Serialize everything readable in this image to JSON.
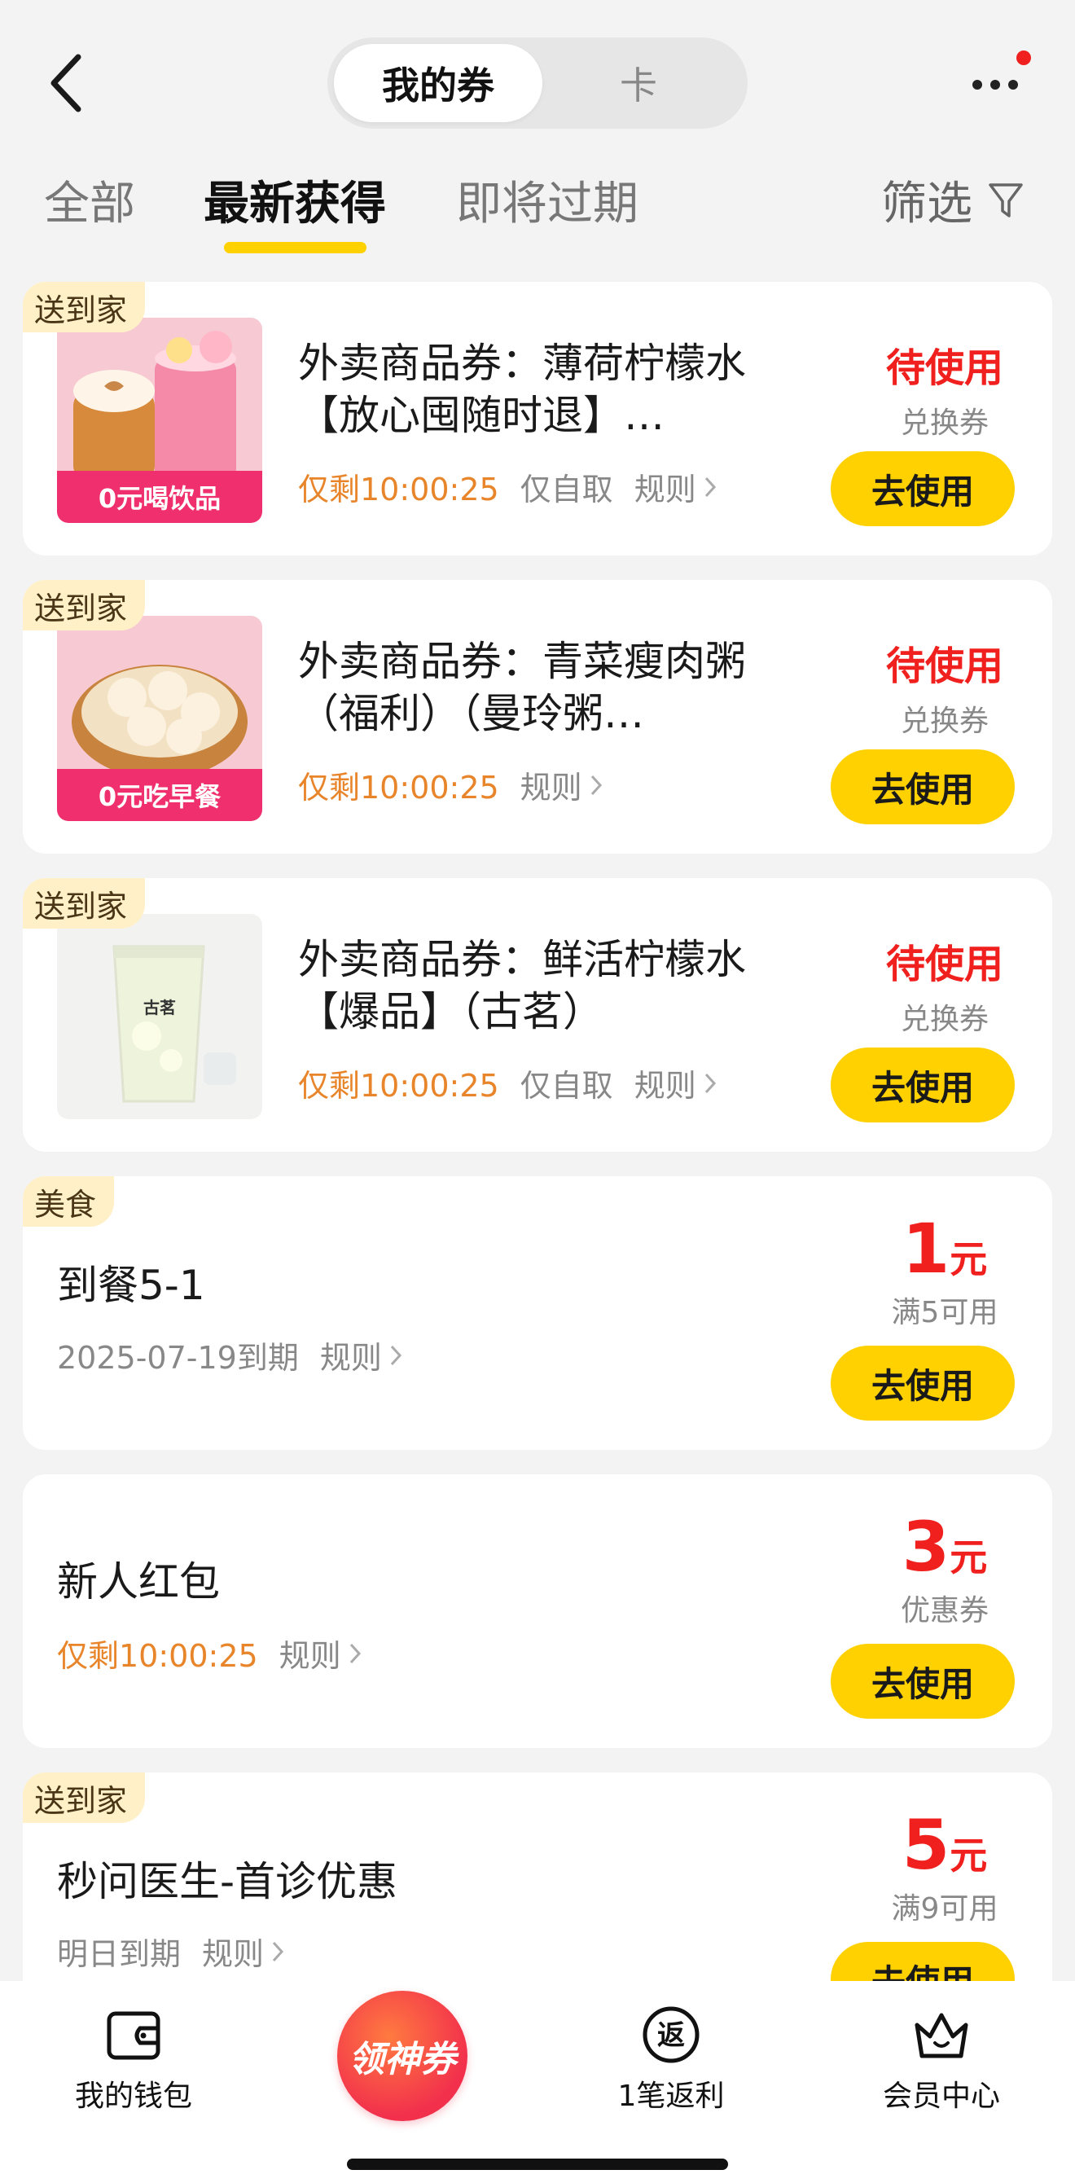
{
  "header": {
    "segments": [
      "我的券",
      "卡"
    ],
    "tabs": [
      "全部",
      "最新获得",
      "即将过期"
    ],
    "filter_label": "筛选"
  },
  "coupons": [
    {
      "tag": "送到家",
      "thumb_banner": "0元喝饮品",
      "title": "外卖商品券：薄荷柠檬水【放心囤随时退】…",
      "countdown": "仅剩10:00:25",
      "pickup": "仅自取",
      "rule": "规则",
      "status": "待使用",
      "type": "兑换券",
      "button": "去使用"
    },
    {
      "tag": "送到家",
      "thumb_banner": "0元吃早餐",
      "title": "外卖商品券：青菜瘦肉粥（福利）（曼玲粥…",
      "countdown": "仅剩10:00:25",
      "rule": "规则",
      "status": "待使用",
      "type": "兑换券",
      "button": "去使用"
    },
    {
      "tag": "送到家",
      "thumb_label": "古茗",
      "title": "外卖商品券：鲜活柠檬水【爆品】（古茗）",
      "countdown": "仅剩10:00:25",
      "pickup": "仅自取",
      "rule": "规则",
      "status": "待使用",
      "type": "兑换券",
      "button": "去使用"
    },
    {
      "tag": "美食",
      "title": "到餐5-1",
      "expiry": "2025-07-19到期",
      "rule": "规则",
      "amount": "1",
      "unit": "元",
      "type": "满5可用",
      "button": "去使用"
    },
    {
      "title": "新人红包",
      "countdown": "仅剩10:00:25",
      "rule": "规则",
      "amount": "3",
      "unit": "元",
      "type": "优惠券",
      "button": "去使用"
    },
    {
      "tag": "送到家",
      "title": "秒问医生-首诊优惠",
      "expiry": "明日到期",
      "rule": "规则",
      "amount": "5",
      "unit": "元",
      "type": "满9可用",
      "button": "去使用"
    }
  ],
  "bottom_nav": {
    "wallet": "我的钱包",
    "center": "领神券",
    "rebate_icon": "返",
    "rebate": "1笔返利",
    "member": "会员中心"
  },
  "colors": {
    "accent_yellow": "#ffd100",
    "status_red": "#f0201e",
    "countdown_orange": "#e8852a",
    "tag_bg": "#fff0c8"
  }
}
